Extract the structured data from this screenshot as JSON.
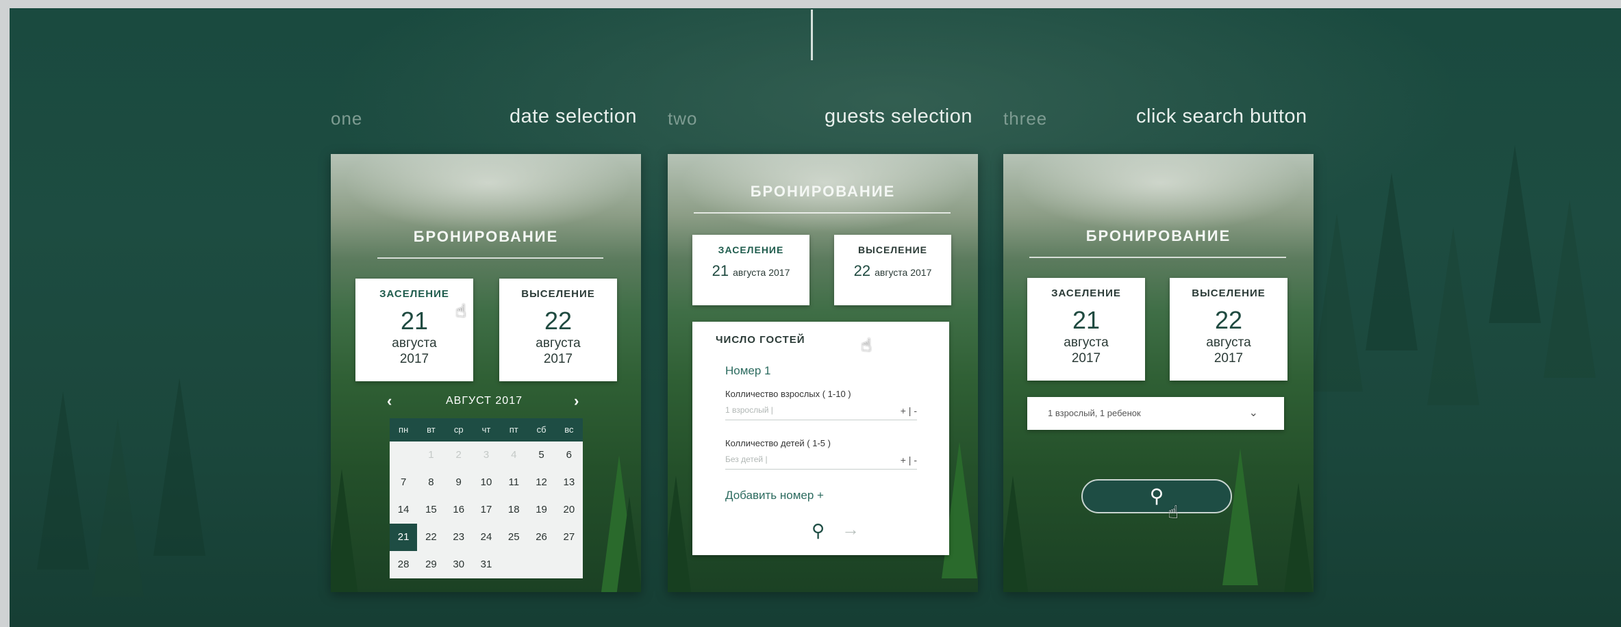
{
  "steps": [
    {
      "number": "one",
      "title": "date selection"
    },
    {
      "number": "two",
      "title": "guests selection"
    },
    {
      "number": "three",
      "title": "click search button"
    }
  ],
  "panel_title": "БРОНИРОВАНИЕ",
  "checkin": {
    "label": "ЗАСЕЛЕНИЕ",
    "day": "21",
    "month": "августа",
    "year": "2017",
    "short": "августа 2017"
  },
  "checkout": {
    "label": "ВЫСЕЛЕНИЕ",
    "day": "22",
    "month": "августа",
    "year": "2017",
    "short": "августа 2017"
  },
  "calendar": {
    "month_label": "АВГУСТ 2017",
    "prev_icon": "chevron-left-icon",
    "next_icon": "chevron-right-icon",
    "weekdays": [
      "пн",
      "вт",
      "ср",
      "чт",
      "пт",
      "сб",
      "вс"
    ],
    "weeks": [
      [
        "",
        "1",
        "2",
        "3",
        "4",
        "5",
        "6"
      ],
      [
        "7",
        "8",
        "9",
        "10",
        "11",
        "12",
        "13"
      ],
      [
        "14",
        "15",
        "16",
        "17",
        "18",
        "19",
        "20"
      ],
      [
        "21",
        "22",
        "23",
        "24",
        "25",
        "26",
        "27"
      ],
      [
        "28",
        "29",
        "30",
        "31",
        "",
        "",
        ""
      ]
    ],
    "selected": "21"
  },
  "guests": {
    "heading": "ЧИСЛО ГОСТЕЙ",
    "room": "Номер 1",
    "adults_label": "Колличество взрослых ( 1-10 )",
    "adults_value": "1 взрослый |",
    "children_label": "Колличество детей ( 1-5 )",
    "children_value": "Без детей |",
    "stepper": "+ | -",
    "add_room": "Добавить номер +",
    "search_icon": "search-icon",
    "next_icon": "arrow-right-icon"
  },
  "summary_select": {
    "value": "1 взрослый, 1 ребенок",
    "icon": "chevron-down-icon"
  },
  "search_button": {
    "icon": "search-icon"
  },
  "colors": {
    "accent": "#1e4d44",
    "link": "#2c6b5f",
    "background": "#1b473c"
  }
}
